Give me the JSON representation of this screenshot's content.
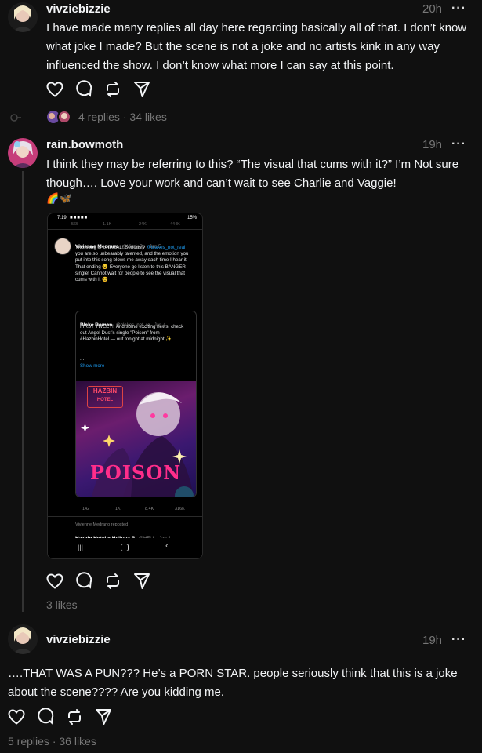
{
  "posts": [
    {
      "username": "vivziebizzie",
      "time": "20h",
      "more": "···",
      "text": "I have made many replies all day here regarding basically all of that. I don’t know what joke I made? But the scene is not a joke and no artists kink in any way influenced the show. I don’t know what more I can say at this point.",
      "replies": "4 replies",
      "sep": "·",
      "likes": "34 likes"
    },
    {
      "username": "rain.bowmoth",
      "time": "19h",
      "more": "···",
      "text": "I think they may be referring to this? “The visual that cums with it?” I’m Not sure though…. Love your work and can’t wait to see Charlie and Vaggie!",
      "emoji": "🌈🦋",
      "likes": "3 likes"
    },
    {
      "username": "vivziebizzie",
      "time": "19h",
      "more": "···",
      "text": "….THAT WAS A PUN??? He’s a PORN STAR. people seriously think that this is a joke about the scene???? Are you kidding me.",
      "replies": "5 replies",
      "sep": "·",
      "likes": "36 likes"
    }
  ],
  "screenshot": {
    "status_time": "7:19",
    "status_battery": "15%",
    "top_counts": [
      "565",
      "1.1K",
      "24K",
      "444K"
    ],
    "tweet_name": "Vivienne Medrano",
    "tweet_handle": "@VivziePo · Jan 5",
    "tweet_text_1": "This song is UNREAL! Seriously",
    "tweet_mention": "@blakes_not_real",
    "tweet_text_2": "you are so unbearably talented, and the emotion you put into this song blows me away each time I hear it. That ending 😮 Everyone go listen to this BANGER single! Cannot wait for people to see the visual that cums with it 😉",
    "quote_name": "Blake Roman",
    "quote_handle": "@blakes_not_re · Jan 4",
    "quote_text": "FIRST TWEET!! And some exciting news: check out Angel Dust’s single \"Poison\" from #HazbinHotel — out tonight at midnight ✨",
    "quote_ellipsis": "...",
    "show_more": "Show more",
    "poster_logo_1": "HAZBIN",
    "poster_logo_2": "HOTEL",
    "poster_title": "POISON",
    "bottom_counts": [
      "142",
      "1K",
      "8.4K",
      "316K"
    ],
    "next_reposted": "Vivienne Medrano reposted",
    "next_title": "Hazbin Hotel + Helluva B",
    "next_handle": "@HELL · Jan 4"
  }
}
